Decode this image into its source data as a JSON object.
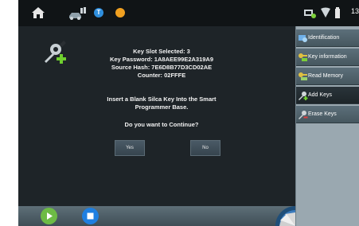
{
  "status_bar": {
    "t_badge": "T",
    "o_badge": "",
    "time": "13",
    "icons": [
      "home-icon",
      "car-icon",
      "t-badge-icon",
      "orange-badge-icon",
      "network-icon",
      "wifi-icon",
      "battery-icon"
    ]
  },
  "dialog": {
    "key_slot": "Key Slot Selected: 3",
    "key_password": "Key Password: 1A8AEE99E2A319A9",
    "source_hash": "Source Hash: 7E6D8B77D3CD02AE",
    "counter": "Counter: 02FFFE",
    "message": "Insert a Blank Silca Key Into the Smart Programmer Base.",
    "question": "Do you want to Continue?",
    "yes_label": "Yes",
    "no_label": "No"
  },
  "sidebar": {
    "items": [
      {
        "label": "Identification",
        "icon": "identification-icon",
        "selected": false
      },
      {
        "label": "Key information",
        "icon": "key-info-icon",
        "selected": false
      },
      {
        "label": "Read Memory",
        "icon": "read-memory-icon",
        "selected": false
      },
      {
        "label": "Add Keys",
        "icon": "add-key-icon",
        "selected": true
      },
      {
        "label": "Erase Keys",
        "icon": "erase-key-icon",
        "selected": false
      }
    ]
  },
  "colors": {
    "play": "#6dbb45",
    "stop": "#1f7fe0",
    "accent_green": "#7ccf3a"
  }
}
